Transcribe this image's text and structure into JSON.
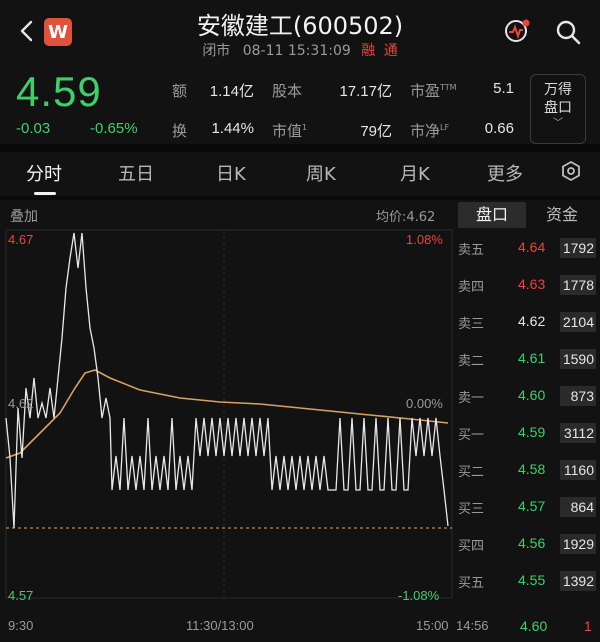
{
  "header": {
    "logo_letter": "W",
    "title": "安徽建工(600502)",
    "status": "闭市",
    "datetime": "08-11 15:31:09",
    "tag_margin": "融",
    "tag_connect": "通"
  },
  "quote": {
    "price": "4.59",
    "change": "-0.03",
    "change_pct": "-0.65%",
    "stats": [
      {
        "label": "额",
        "value": "1.14亿"
      },
      {
        "label": "股本",
        "value": "17.17亿"
      },
      {
        "label": "市盈",
        "sup": "TTM",
        "value": "5.1"
      },
      {
        "label": "换",
        "value": "1.44%"
      },
      {
        "label": "市值",
        "sup": "1",
        "value": "79亿"
      },
      {
        "label": "市净",
        "sup": "LF",
        "value": "0.66"
      }
    ],
    "fold_button": "万得\n盘口"
  },
  "tabs": [
    "分时",
    "五日",
    "日K",
    "周K",
    "月K",
    "更多"
  ],
  "chart": {
    "overlay_label": "叠加",
    "avg_label": "均价:4.62",
    "left_top": "4.67",
    "left_mid": "4.62",
    "left_bottom": "4.57",
    "right_top": "1.08%",
    "right_mid": "0.00%",
    "right_bottom": "-1.08%",
    "x_start": "9:30",
    "x_mid": "11:30/13:00",
    "x_end": "15:00",
    "colors": {
      "up": "#e8453c",
      "down": "#3fcf6a",
      "price_line": "#e8e8e8",
      "avg_line": "#d9a060",
      "base_line": "#e8a33c"
    }
  },
  "orderbook": {
    "tab_active": "盘口",
    "tab_other": "资金",
    "rows": [
      {
        "label": "卖五",
        "price": "4.64",
        "vol": "1792",
        "color": "#e8453c"
      },
      {
        "label": "卖四",
        "price": "4.63",
        "vol": "1778",
        "color": "#e8453c"
      },
      {
        "label": "卖三",
        "price": "4.62",
        "vol": "2104",
        "color": "#e6e6e6"
      },
      {
        "label": "卖二",
        "price": "4.61",
        "vol": "1590",
        "color": "#3fcf6a"
      },
      {
        "label": "卖一",
        "price": "4.60",
        "vol": "873",
        "color": "#3fcf6a"
      },
      {
        "label": "买一",
        "price": "4.59",
        "vol": "3112",
        "color": "#3fcf6a"
      },
      {
        "label": "买二",
        "price": "4.58",
        "vol": "1160",
        "color": "#3fcf6a"
      },
      {
        "label": "买三",
        "price": "4.57",
        "vol": "864",
        "color": "#3fcf6a"
      },
      {
        "label": "买四",
        "price": "4.56",
        "vol": "1929",
        "color": "#3fcf6a"
      },
      {
        "label": "买五",
        "price": "4.55",
        "vol": "1392",
        "color": "#3fcf6a"
      }
    ],
    "last_trade": {
      "time": "14:56",
      "price": "4.60",
      "vol": "1"
    }
  }
}
